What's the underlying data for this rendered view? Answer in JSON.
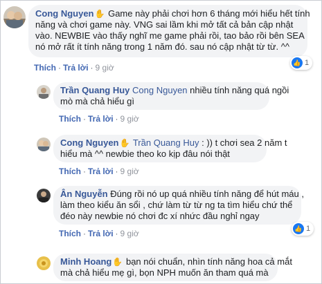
{
  "actions": {
    "like": "Thích",
    "reply": "Trả lời",
    "separator": "·"
  },
  "comments": [
    {
      "author": "Cong Nguyen",
      "lines": [
        "Game này phải chơi hơn 6 tháng mới hiểu hết tính",
        "năng và chơi game này. VNG sai lầm khi mở tất cả bản cập nhật",
        "vào. NEWBIE vào thấy nghĩ me game phải rồi, tao bảo rồi bên SEA",
        "nó mở rất ít tính năng trong 1 năm đó. sau nó cập nhật từ từ. ^^"
      ],
      "time": "9 giờ",
      "reactions": "1"
    },
    {
      "author": "Trần Quang Huy",
      "mention": "Cong Nguyen",
      "lines": [
        "nhiều tính năng quá ngồi",
        "mò mà chả hiểu gì"
      ],
      "time": "9 giờ"
    },
    {
      "author": "Cong Nguyen",
      "mention": "Trần Quang Huy",
      "lines": [
        ": )) t chơi sea 2 năm t",
        "hiểu mà ^^ newbie theo ko kịp đâu nói thật"
      ],
      "time": "9 giờ"
    },
    {
      "author": "Ân Nguyễn",
      "lines": [
        "Đúng rồi nó up quá nhiều tính năng để hút máu ,",
        "làm theo kiểu ăn sổi , chứ làm từ từ ng ta tìm hiểu chứ thể",
        "đéo này newbie nó chơi đc xí nhức đầu nghỉ ngay"
      ],
      "time": "9 giờ",
      "reactions": "1"
    },
    {
      "author": "Minh Hoang",
      "lines": [
        "bạn nói chuẩn, nhìn tính năng hoa cả mắt",
        "mà chả hiểu mẹ gì, bọn NPH muốn ăn tham quá mà"
      ]
    }
  ]
}
